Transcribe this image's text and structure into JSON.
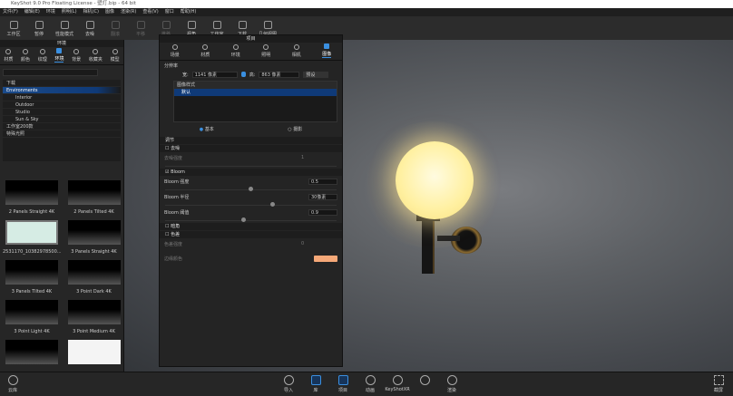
{
  "window": {
    "title": "KeyShot 9.0 Pro Floating License - 壁灯.bip - 64 bit"
  },
  "menu": [
    "文件(F)",
    "编辑(E)",
    "环境",
    "照明(L)",
    "相机(C)",
    "图像",
    "渲染(R)",
    "查看(V)",
    "窗口",
    "帮助(H)"
  ],
  "toolbar": [
    {
      "label": "工作区",
      "dim": false
    },
    {
      "label": "暂停",
      "dim": false
    },
    {
      "label": "性能模式",
      "dim": false
    },
    {
      "label": "去噪",
      "dim": false
    },
    {
      "label": "翻滚",
      "dim": true
    },
    {
      "label": "平移",
      "dim": true
    },
    {
      "label": "推移",
      "dim": true
    },
    {
      "label": "视角",
      "dim": false
    },
    {
      "label": "工作室",
      "dim": false
    },
    {
      "label": "下载",
      "dim": false
    },
    {
      "label": "几何视图",
      "dim": false
    }
  ],
  "library": {
    "title": "环境",
    "tabs": [
      "材质",
      "颜色",
      "纹理",
      "环境",
      "背景",
      "收藏夹",
      "模型"
    ],
    "active_tab": 3,
    "tree": [
      "下载",
      "Environments",
      "Interior",
      "Outdoor",
      "Studio",
      "Sun & Sky",
      "工作室200款",
      "特殊光照"
    ],
    "thumbs": [
      "2 Panels Straight 4K",
      "2 Panels Tilted 4K",
      "2531170_10382978500...",
      "3 Panels Straight 4K",
      "3 Panels Tilted 4K",
      "3 Point Dark 4K",
      "3 Point Light 4K",
      "3 Point Medium 4K",
      "",
      ""
    ]
  },
  "project": {
    "title": "项目",
    "tabs": [
      "场景",
      "材质",
      "环境",
      "照明",
      "相机",
      "图像"
    ],
    "active_tab": 5,
    "resolution_label": "分辨率",
    "width_label": "宽:",
    "width": "1141 像素",
    "height_label": "高:",
    "height": "863 像素",
    "preset": "预设",
    "style_header": "图像样式",
    "style_item": "默认",
    "mode_basic": "基本",
    "mode_photo": "摄影",
    "adjust": "调节",
    "denoise": "去噪",
    "denoise_strength": "去噪强度",
    "denoise_value": "1",
    "bloom": "Bloom",
    "bloom_intensity": "Bloom 强度",
    "bloom_intensity_value": "0.5",
    "bloom_radius": "Bloom 半径",
    "bloom_radius_value": "30像素",
    "bloom_threshold": "Bloom 阈值",
    "bloom_threshold_value": "0.9",
    "vignette": "暗角",
    "chromatic": "色差",
    "chromatic_strength": "色差强度",
    "chromatic_value": "0",
    "color_label": "边缘颜色",
    "swatch_color": "#f5a878"
  },
  "bottom": {
    "cloud": "云库",
    "items": [
      "导入",
      "库",
      "项目",
      "动画",
      "KeyShotXR",
      "",
      "渲染"
    ],
    "screenshot": "截屏"
  }
}
